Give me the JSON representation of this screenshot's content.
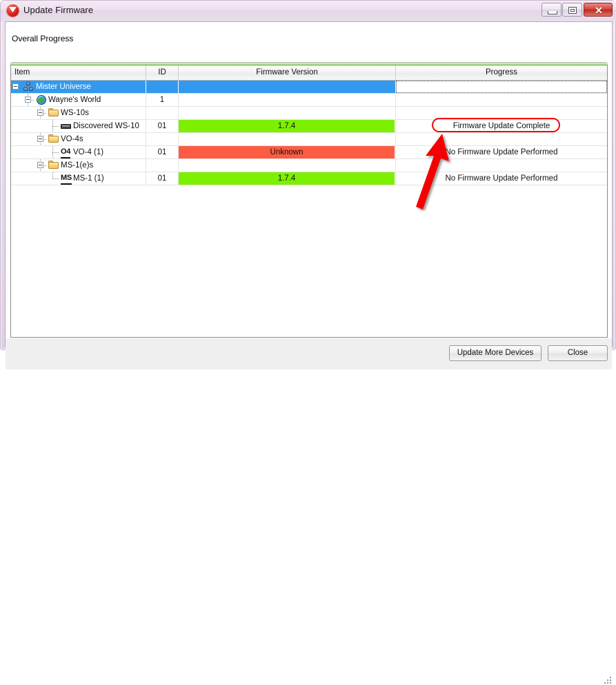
{
  "window": {
    "title": "Update Firmware",
    "app_icon": "shield-v-icon",
    "controls": {
      "minimize": "minimize-icon",
      "maximize": "maximize-icon",
      "close": "✕"
    }
  },
  "progress": {
    "label": "Overall Progress",
    "percent": 100,
    "color": "#0fc800"
  },
  "grid": {
    "columns": [
      {
        "key": "item",
        "label": "Item",
        "align": "left"
      },
      {
        "key": "id",
        "label": "ID",
        "align": "center"
      },
      {
        "key": "firmware",
        "label": "Firmware Version",
        "align": "center"
      },
      {
        "key": "progress",
        "label": "Progress",
        "align": "center"
      }
    ],
    "rows": [
      {
        "item": "Mister Universe",
        "icon": "network-icon",
        "depth": 0,
        "expanded": true,
        "selected": true,
        "id": "",
        "firmware": "",
        "firmware_color": "",
        "progress": ""
      },
      {
        "item": "Wayne's World",
        "icon": "globe-icon",
        "depth": 1,
        "expanded": true,
        "selected": false,
        "id": "1",
        "firmware": "",
        "firmware_color": "",
        "progress": ""
      },
      {
        "item": "WS-10s",
        "icon": "folder-icon",
        "depth": 2,
        "expanded": true,
        "selected": false,
        "id": "",
        "firmware": "",
        "firmware_color": "",
        "progress": ""
      },
      {
        "item": "Discovered WS-10",
        "icon": "device-icon",
        "depth": 3,
        "expanded": false,
        "selected": false,
        "id": "01",
        "firmware": "1.7.4",
        "firmware_color": "#7cf000",
        "progress": "Firmware Update Complete"
      },
      {
        "item": "VO-4s",
        "icon": "folder-icon",
        "depth": 2,
        "expanded": true,
        "selected": false,
        "id": "",
        "firmware": "",
        "firmware_color": "",
        "progress": ""
      },
      {
        "item": "VO-4 (1)",
        "icon": "o4-badge-icon",
        "icon_text": "O4",
        "depth": 3,
        "expanded": false,
        "selected": false,
        "id": "01",
        "firmware": "Unknown",
        "firmware_color": "#fc5c42",
        "progress": "No Firmware Update Performed"
      },
      {
        "item": "MS-1(e)s",
        "icon": "folder-icon",
        "depth": 2,
        "expanded": true,
        "selected": false,
        "id": "",
        "firmware": "",
        "firmware_color": "",
        "progress": ""
      },
      {
        "item": "MS-1 (1)",
        "icon": "ms-badge-icon",
        "icon_text": "MS",
        "depth": 3,
        "expanded": false,
        "selected": false,
        "id": "01",
        "firmware": "1.7.4",
        "firmware_color": "#7cf000",
        "progress": "No Firmware Update Performed"
      }
    ]
  },
  "footer": {
    "update_more_label": "Update More Devices",
    "close_label": "Close"
  },
  "annotation": {
    "highlight_target": "Firmware Update Complete",
    "color": "#f50000"
  }
}
